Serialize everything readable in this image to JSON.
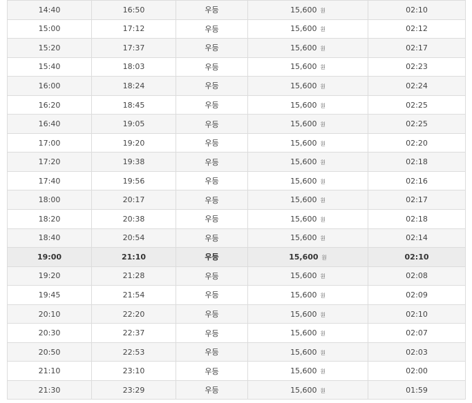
{
  "schedule": {
    "rows": [
      {
        "departure": "14:40",
        "arrival": "16:50",
        "grade": "우등",
        "fare": "15,600",
        "fare_unit": "원",
        "duration": "02:10",
        "highlight": false
      },
      {
        "departure": "15:00",
        "arrival": "17:12",
        "grade": "우등",
        "fare": "15,600",
        "fare_unit": "원",
        "duration": "02:12",
        "highlight": false
      },
      {
        "departure": "15:20",
        "arrival": "17:37",
        "grade": "우등",
        "fare": "15,600",
        "fare_unit": "원",
        "duration": "02:17",
        "highlight": false
      },
      {
        "departure": "15:40",
        "arrival": "18:03",
        "grade": "우등",
        "fare": "15,600",
        "fare_unit": "원",
        "duration": "02:23",
        "highlight": false
      },
      {
        "departure": "16:00",
        "arrival": "18:24",
        "grade": "우등",
        "fare": "15,600",
        "fare_unit": "원",
        "duration": "02:24",
        "highlight": false
      },
      {
        "departure": "16:20",
        "arrival": "18:45",
        "grade": "우등",
        "fare": "15,600",
        "fare_unit": "원",
        "duration": "02:25",
        "highlight": false
      },
      {
        "departure": "16:40",
        "arrival": "19:05",
        "grade": "우등",
        "fare": "15,600",
        "fare_unit": "원",
        "duration": "02:25",
        "highlight": false
      },
      {
        "departure": "17:00",
        "arrival": "19:20",
        "grade": "우등",
        "fare": "15,600",
        "fare_unit": "원",
        "duration": "02:20",
        "highlight": false
      },
      {
        "departure": "17:20",
        "arrival": "19:38",
        "grade": "우등",
        "fare": "15,600",
        "fare_unit": "원",
        "duration": "02:18",
        "highlight": false
      },
      {
        "departure": "17:40",
        "arrival": "19:56",
        "grade": "우등",
        "fare": "15,600",
        "fare_unit": "원",
        "duration": "02:16",
        "highlight": false
      },
      {
        "departure": "18:00",
        "arrival": "20:17",
        "grade": "우등",
        "fare": "15,600",
        "fare_unit": "원",
        "duration": "02:17",
        "highlight": false
      },
      {
        "departure": "18:20",
        "arrival": "20:38",
        "grade": "우등",
        "fare": "15,600",
        "fare_unit": "원",
        "duration": "02:18",
        "highlight": false
      },
      {
        "departure": "18:40",
        "arrival": "20:54",
        "grade": "우등",
        "fare": "15,600",
        "fare_unit": "원",
        "duration": "02:14",
        "highlight": false
      },
      {
        "departure": "19:00",
        "arrival": "21:10",
        "grade": "우등",
        "fare": "15,600",
        "fare_unit": "원",
        "duration": "02:10",
        "highlight": true
      },
      {
        "departure": "19:20",
        "arrival": "21:28",
        "grade": "우등",
        "fare": "15,600",
        "fare_unit": "원",
        "duration": "02:08",
        "highlight": false
      },
      {
        "departure": "19:45",
        "arrival": "21:54",
        "grade": "우등",
        "fare": "15,600",
        "fare_unit": "원",
        "duration": "02:09",
        "highlight": false
      },
      {
        "departure": "20:10",
        "arrival": "22:20",
        "grade": "우등",
        "fare": "15,600",
        "fare_unit": "원",
        "duration": "02:10",
        "highlight": false
      },
      {
        "departure": "20:30",
        "arrival": "22:37",
        "grade": "우등",
        "fare": "15,600",
        "fare_unit": "원",
        "duration": "02:07",
        "highlight": false
      },
      {
        "departure": "20:50",
        "arrival": "22:53",
        "grade": "우등",
        "fare": "15,600",
        "fare_unit": "원",
        "duration": "02:03",
        "highlight": false
      },
      {
        "departure": "21:10",
        "arrival": "23:10",
        "grade": "우등",
        "fare": "15,600",
        "fare_unit": "원",
        "duration": "02:00",
        "highlight": false
      },
      {
        "departure": "21:30",
        "arrival": "23:29",
        "grade": "우등",
        "fare": "15,600",
        "fare_unit": "원",
        "duration": "01:59",
        "highlight": false
      }
    ]
  },
  "colors": {
    "border": "#dcdcdc",
    "row_odd": "#f5f5f5",
    "row_even": "#ffffff",
    "row_highlight": "#ececec",
    "text": "#444444"
  }
}
